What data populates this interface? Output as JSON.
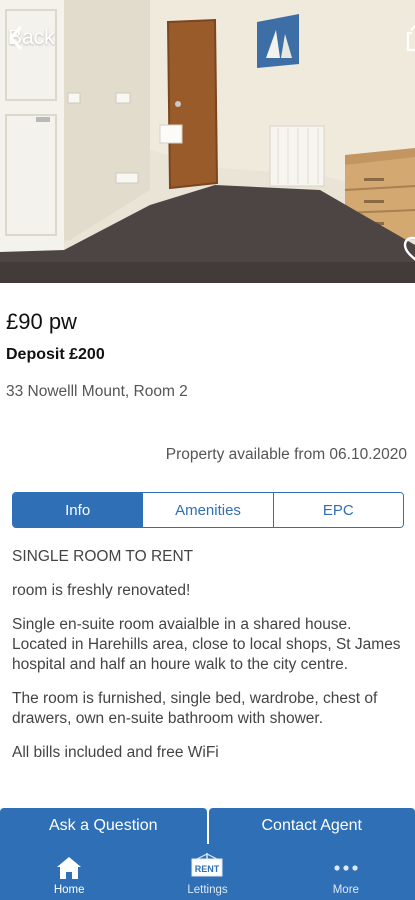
{
  "header": {
    "back_label": "Back"
  },
  "listing": {
    "price": "£90 pw",
    "deposit": "Deposit £200",
    "address": "33 Nowelll Mount, Room 2",
    "available": "Property available from 06.10.2020"
  },
  "tabs": [
    {
      "label": "Info",
      "active": true
    },
    {
      "label": "Amenities",
      "active": false
    },
    {
      "label": "EPC",
      "active": false
    }
  ],
  "description": [
    "SINGLE ROOM TO RENT",
    "room is freshly renovated!",
    "Single en-suite room avaialble in a shared house. Located in Harehills area, close to local shops, St James hospital and half an houre walk to the city centre.",
    "The room is furnished, single bed, wardrobe, chest of drawers, own en-suite bathroom with shower.",
    "All bills included and free WiFi"
  ],
  "actions": {
    "ask": "Ask a Question",
    "contact": "Contact Agent"
  },
  "nav": [
    {
      "label": "Home",
      "icon": "home-icon",
      "active": true
    },
    {
      "label": "Lettings",
      "icon": "rent-sign-icon",
      "active": false,
      "badge": "RENT"
    },
    {
      "label": "More",
      "icon": "more-dots-icon",
      "active": false
    }
  ],
  "colors": {
    "primary": "#2e6fb5"
  }
}
